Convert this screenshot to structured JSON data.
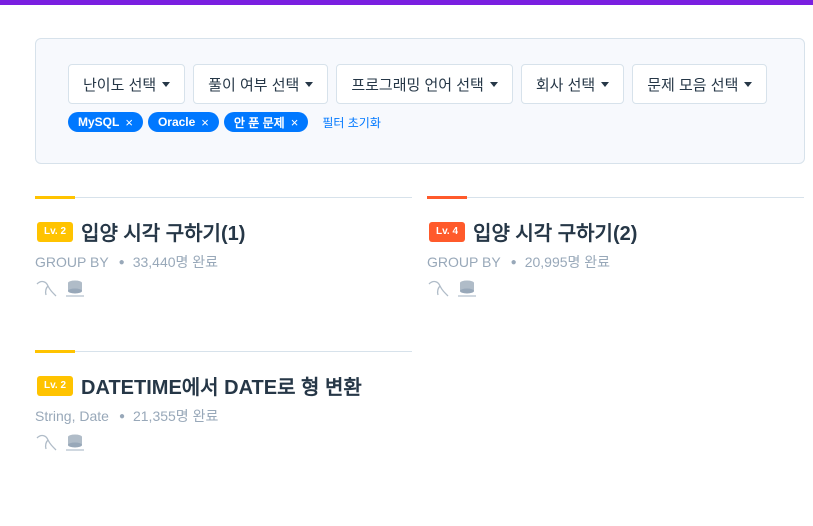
{
  "filters": {
    "dropdowns": [
      "난이도 선택",
      "풀이 여부 선택",
      "프로그래밍 언어 선택",
      "회사 선택",
      "문제 모음 선택"
    ],
    "chips": [
      "MySQL",
      "Oracle",
      "안 푼 문제"
    ],
    "chip_close": "×",
    "reset_label": "필터 초기화"
  },
  "cards": [
    {
      "level": "Lv. 2",
      "level_color": "#ffc300",
      "title": "입양 시각 구하기(1)",
      "category": "GROUP BY",
      "completed": "33,440명 완료",
      "languages": [
        "mysql-icon",
        "oracle-icon"
      ]
    },
    {
      "level": "Lv. 4",
      "level_color": "#ff5a2b",
      "title": "입양 시각 구하기(2)",
      "category": "GROUP BY",
      "completed": "20,995명 완료",
      "languages": [
        "mysql-icon",
        "oracle-icon"
      ]
    },
    {
      "level": "Lv. 2",
      "level_color": "#ffc300",
      "title": "DATETIME에서 DATE로 형 변환",
      "category": "String, Date",
      "completed": "21,355명 완료",
      "languages": [
        "mysql-icon",
        "oracle-icon"
      ]
    }
  ],
  "colors": {
    "accent": "#7a1fe0",
    "chip": "#0078ff"
  }
}
